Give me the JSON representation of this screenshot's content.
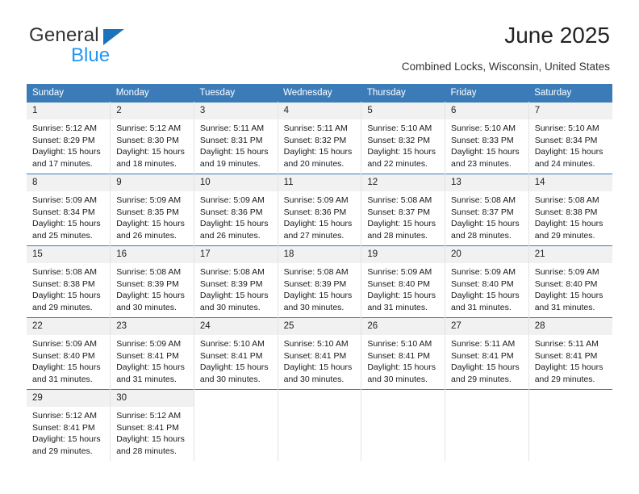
{
  "brand": {
    "name_top": "General",
    "name_bottom": "Blue",
    "accent_color": "#1c72bb",
    "blue_color": "#2196f3"
  },
  "header": {
    "title": "June 2025",
    "subtitle": "Combined Locks, Wisconsin, United States"
  },
  "calendar": {
    "header_bg": "#3b7cb8",
    "daynum_bg": "#f1f1f1",
    "weekdays": [
      "Sunday",
      "Monday",
      "Tuesday",
      "Wednesday",
      "Thursday",
      "Friday",
      "Saturday"
    ],
    "weeks": [
      [
        {
          "day": "1",
          "sunrise": "Sunrise: 5:12 AM",
          "sunset": "Sunset: 8:29 PM",
          "daylight1": "Daylight: 15 hours",
          "daylight2": "and 17 minutes."
        },
        {
          "day": "2",
          "sunrise": "Sunrise: 5:12 AM",
          "sunset": "Sunset: 8:30 PM",
          "daylight1": "Daylight: 15 hours",
          "daylight2": "and 18 minutes."
        },
        {
          "day": "3",
          "sunrise": "Sunrise: 5:11 AM",
          "sunset": "Sunset: 8:31 PM",
          "daylight1": "Daylight: 15 hours",
          "daylight2": "and 19 minutes."
        },
        {
          "day": "4",
          "sunrise": "Sunrise: 5:11 AM",
          "sunset": "Sunset: 8:32 PM",
          "daylight1": "Daylight: 15 hours",
          "daylight2": "and 20 minutes."
        },
        {
          "day": "5",
          "sunrise": "Sunrise: 5:10 AM",
          "sunset": "Sunset: 8:32 PM",
          "daylight1": "Daylight: 15 hours",
          "daylight2": "and 22 minutes."
        },
        {
          "day": "6",
          "sunrise": "Sunrise: 5:10 AM",
          "sunset": "Sunset: 8:33 PM",
          "daylight1": "Daylight: 15 hours",
          "daylight2": "and 23 minutes."
        },
        {
          "day": "7",
          "sunrise": "Sunrise: 5:10 AM",
          "sunset": "Sunset: 8:34 PM",
          "daylight1": "Daylight: 15 hours",
          "daylight2": "and 24 minutes."
        }
      ],
      [
        {
          "day": "8",
          "sunrise": "Sunrise: 5:09 AM",
          "sunset": "Sunset: 8:34 PM",
          "daylight1": "Daylight: 15 hours",
          "daylight2": "and 25 minutes."
        },
        {
          "day": "9",
          "sunrise": "Sunrise: 5:09 AM",
          "sunset": "Sunset: 8:35 PM",
          "daylight1": "Daylight: 15 hours",
          "daylight2": "and 26 minutes."
        },
        {
          "day": "10",
          "sunrise": "Sunrise: 5:09 AM",
          "sunset": "Sunset: 8:36 PM",
          "daylight1": "Daylight: 15 hours",
          "daylight2": "and 26 minutes."
        },
        {
          "day": "11",
          "sunrise": "Sunrise: 5:09 AM",
          "sunset": "Sunset: 8:36 PM",
          "daylight1": "Daylight: 15 hours",
          "daylight2": "and 27 minutes."
        },
        {
          "day": "12",
          "sunrise": "Sunrise: 5:08 AM",
          "sunset": "Sunset: 8:37 PM",
          "daylight1": "Daylight: 15 hours",
          "daylight2": "and 28 minutes."
        },
        {
          "day": "13",
          "sunrise": "Sunrise: 5:08 AM",
          "sunset": "Sunset: 8:37 PM",
          "daylight1": "Daylight: 15 hours",
          "daylight2": "and 28 minutes."
        },
        {
          "day": "14",
          "sunrise": "Sunrise: 5:08 AM",
          "sunset": "Sunset: 8:38 PM",
          "daylight1": "Daylight: 15 hours",
          "daylight2": "and 29 minutes."
        }
      ],
      [
        {
          "day": "15",
          "sunrise": "Sunrise: 5:08 AM",
          "sunset": "Sunset: 8:38 PM",
          "daylight1": "Daylight: 15 hours",
          "daylight2": "and 29 minutes."
        },
        {
          "day": "16",
          "sunrise": "Sunrise: 5:08 AM",
          "sunset": "Sunset: 8:39 PM",
          "daylight1": "Daylight: 15 hours",
          "daylight2": "and 30 minutes."
        },
        {
          "day": "17",
          "sunrise": "Sunrise: 5:08 AM",
          "sunset": "Sunset: 8:39 PM",
          "daylight1": "Daylight: 15 hours",
          "daylight2": "and 30 minutes."
        },
        {
          "day": "18",
          "sunrise": "Sunrise: 5:08 AM",
          "sunset": "Sunset: 8:39 PM",
          "daylight1": "Daylight: 15 hours",
          "daylight2": "and 30 minutes."
        },
        {
          "day": "19",
          "sunrise": "Sunrise: 5:09 AM",
          "sunset": "Sunset: 8:40 PM",
          "daylight1": "Daylight: 15 hours",
          "daylight2": "and 31 minutes."
        },
        {
          "day": "20",
          "sunrise": "Sunrise: 5:09 AM",
          "sunset": "Sunset: 8:40 PM",
          "daylight1": "Daylight: 15 hours",
          "daylight2": "and 31 minutes."
        },
        {
          "day": "21",
          "sunrise": "Sunrise: 5:09 AM",
          "sunset": "Sunset: 8:40 PM",
          "daylight1": "Daylight: 15 hours",
          "daylight2": "and 31 minutes."
        }
      ],
      [
        {
          "day": "22",
          "sunrise": "Sunrise: 5:09 AM",
          "sunset": "Sunset: 8:40 PM",
          "daylight1": "Daylight: 15 hours",
          "daylight2": "and 31 minutes."
        },
        {
          "day": "23",
          "sunrise": "Sunrise: 5:09 AM",
          "sunset": "Sunset: 8:41 PM",
          "daylight1": "Daylight: 15 hours",
          "daylight2": "and 31 minutes."
        },
        {
          "day": "24",
          "sunrise": "Sunrise: 5:10 AM",
          "sunset": "Sunset: 8:41 PM",
          "daylight1": "Daylight: 15 hours",
          "daylight2": "and 30 minutes."
        },
        {
          "day": "25",
          "sunrise": "Sunrise: 5:10 AM",
          "sunset": "Sunset: 8:41 PM",
          "daylight1": "Daylight: 15 hours",
          "daylight2": "and 30 minutes."
        },
        {
          "day": "26",
          "sunrise": "Sunrise: 5:10 AM",
          "sunset": "Sunset: 8:41 PM",
          "daylight1": "Daylight: 15 hours",
          "daylight2": "and 30 minutes."
        },
        {
          "day": "27",
          "sunrise": "Sunrise: 5:11 AM",
          "sunset": "Sunset: 8:41 PM",
          "daylight1": "Daylight: 15 hours",
          "daylight2": "and 29 minutes."
        },
        {
          "day": "28",
          "sunrise": "Sunrise: 5:11 AM",
          "sunset": "Sunset: 8:41 PM",
          "daylight1": "Daylight: 15 hours",
          "daylight2": "and 29 minutes."
        }
      ],
      [
        {
          "day": "29",
          "sunrise": "Sunrise: 5:12 AM",
          "sunset": "Sunset: 8:41 PM",
          "daylight1": "Daylight: 15 hours",
          "daylight2": "and 29 minutes."
        },
        {
          "day": "30",
          "sunrise": "Sunrise: 5:12 AM",
          "sunset": "Sunset: 8:41 PM",
          "daylight1": "Daylight: 15 hours",
          "daylight2": "and 28 minutes."
        },
        {
          "day": "",
          "sunrise": "",
          "sunset": "",
          "daylight1": "",
          "daylight2": ""
        },
        {
          "day": "",
          "sunrise": "",
          "sunset": "",
          "daylight1": "",
          "daylight2": ""
        },
        {
          "day": "",
          "sunrise": "",
          "sunset": "",
          "daylight1": "",
          "daylight2": ""
        },
        {
          "day": "",
          "sunrise": "",
          "sunset": "",
          "daylight1": "",
          "daylight2": ""
        },
        {
          "day": "",
          "sunrise": "",
          "sunset": "",
          "daylight1": "",
          "daylight2": ""
        }
      ]
    ]
  }
}
